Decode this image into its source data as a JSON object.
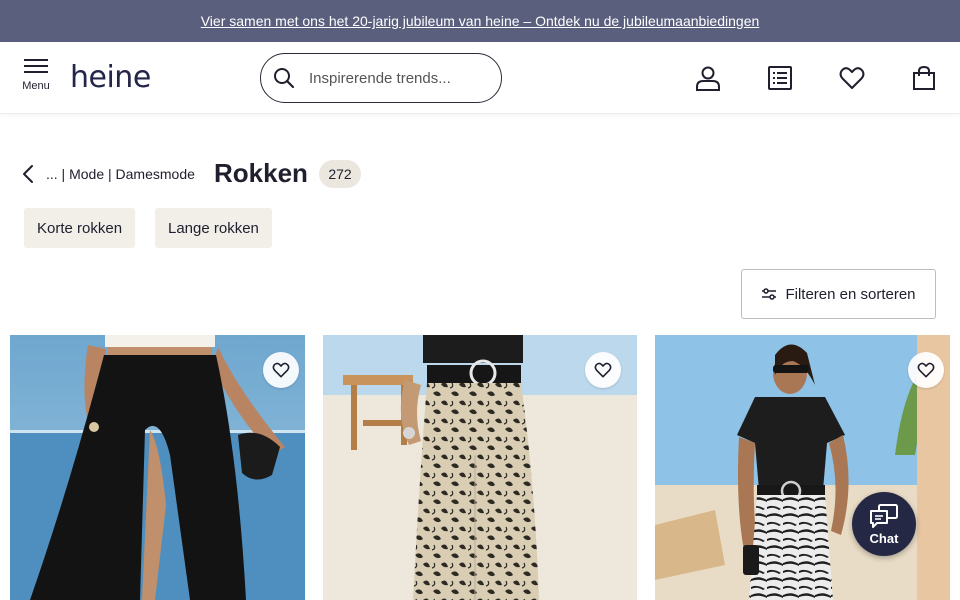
{
  "promo": {
    "text": "Vier samen met ons het 20-jarig jubileum van heine – Ontdek nu de jubileumaanbiedingen"
  },
  "header": {
    "menu_label": "Menu",
    "logo": "heine",
    "search_placeholder": "Inspirerende trends...",
    "icons": [
      "user-icon",
      "order-list-icon",
      "heart-icon",
      "shopping-bag-icon"
    ]
  },
  "breadcrumb": {
    "text": "... | Mode | Damesmode"
  },
  "page": {
    "title": "Rokken",
    "count": "272"
  },
  "chips": [
    {
      "label": "Korte rokken"
    },
    {
      "label": "Lange rokken"
    }
  ],
  "filter": {
    "label": "Filteren en sorteren"
  },
  "products": [
    {
      "image": "black-maxi-wrap-skirt-beach-photo"
    },
    {
      "image": "leaf-print-wide-pants-beach-photo"
    },
    {
      "image": "zebra-print-skirt-beach-photo"
    }
  ],
  "chat": {
    "label": "Chat"
  },
  "colors": {
    "promo_bg": "#5a5f7e",
    "brand_navy": "#23264a",
    "chip_bg": "#f2efe9",
    "chat_bg": "#242844"
  }
}
